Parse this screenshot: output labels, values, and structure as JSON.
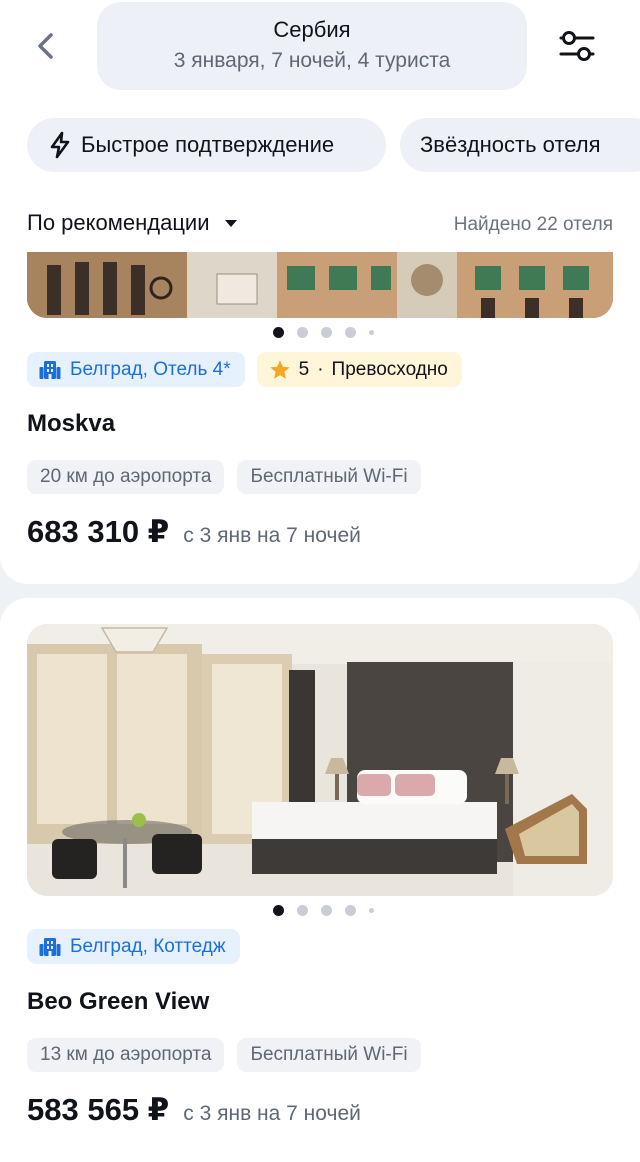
{
  "header": {
    "destination": "Сербия",
    "trip_details": "3 января, 7 ночей, 4 туриста"
  },
  "filters": {
    "fast_confirmation": "Быстрое подтверждение",
    "hotel_stars": "Звёздность отеля"
  },
  "sort": {
    "label": "По рекомендации",
    "found": "Найдено 22 отеля"
  },
  "hotels": [
    {
      "location": "Белград, Отель 4*",
      "rating": "5",
      "rating_text": "Превосходно",
      "name": "Moskva",
      "features": [
        "20 км до аэропорта",
        "Бесплатный Wi-Fi"
      ],
      "price": "683 310 ₽",
      "price_note": "с 3 янв на 7 ночей",
      "active_photo": 1,
      "photo_count": 5
    },
    {
      "location": "Белград, Коттедж",
      "name": "Beo Green View",
      "features": [
        "13 км до аэропорта",
        "Бесплатный Wi-Fi"
      ],
      "price": "583 565 ₽",
      "price_note": "с 3 янв на 7 ночей",
      "active_photo": 1,
      "photo_count": 5
    }
  ],
  "colors": {
    "accent_blue": "#1b6fd9",
    "rating_bg": "#fff5d9",
    "star": "#f5a623",
    "background": "#eef1f6"
  }
}
